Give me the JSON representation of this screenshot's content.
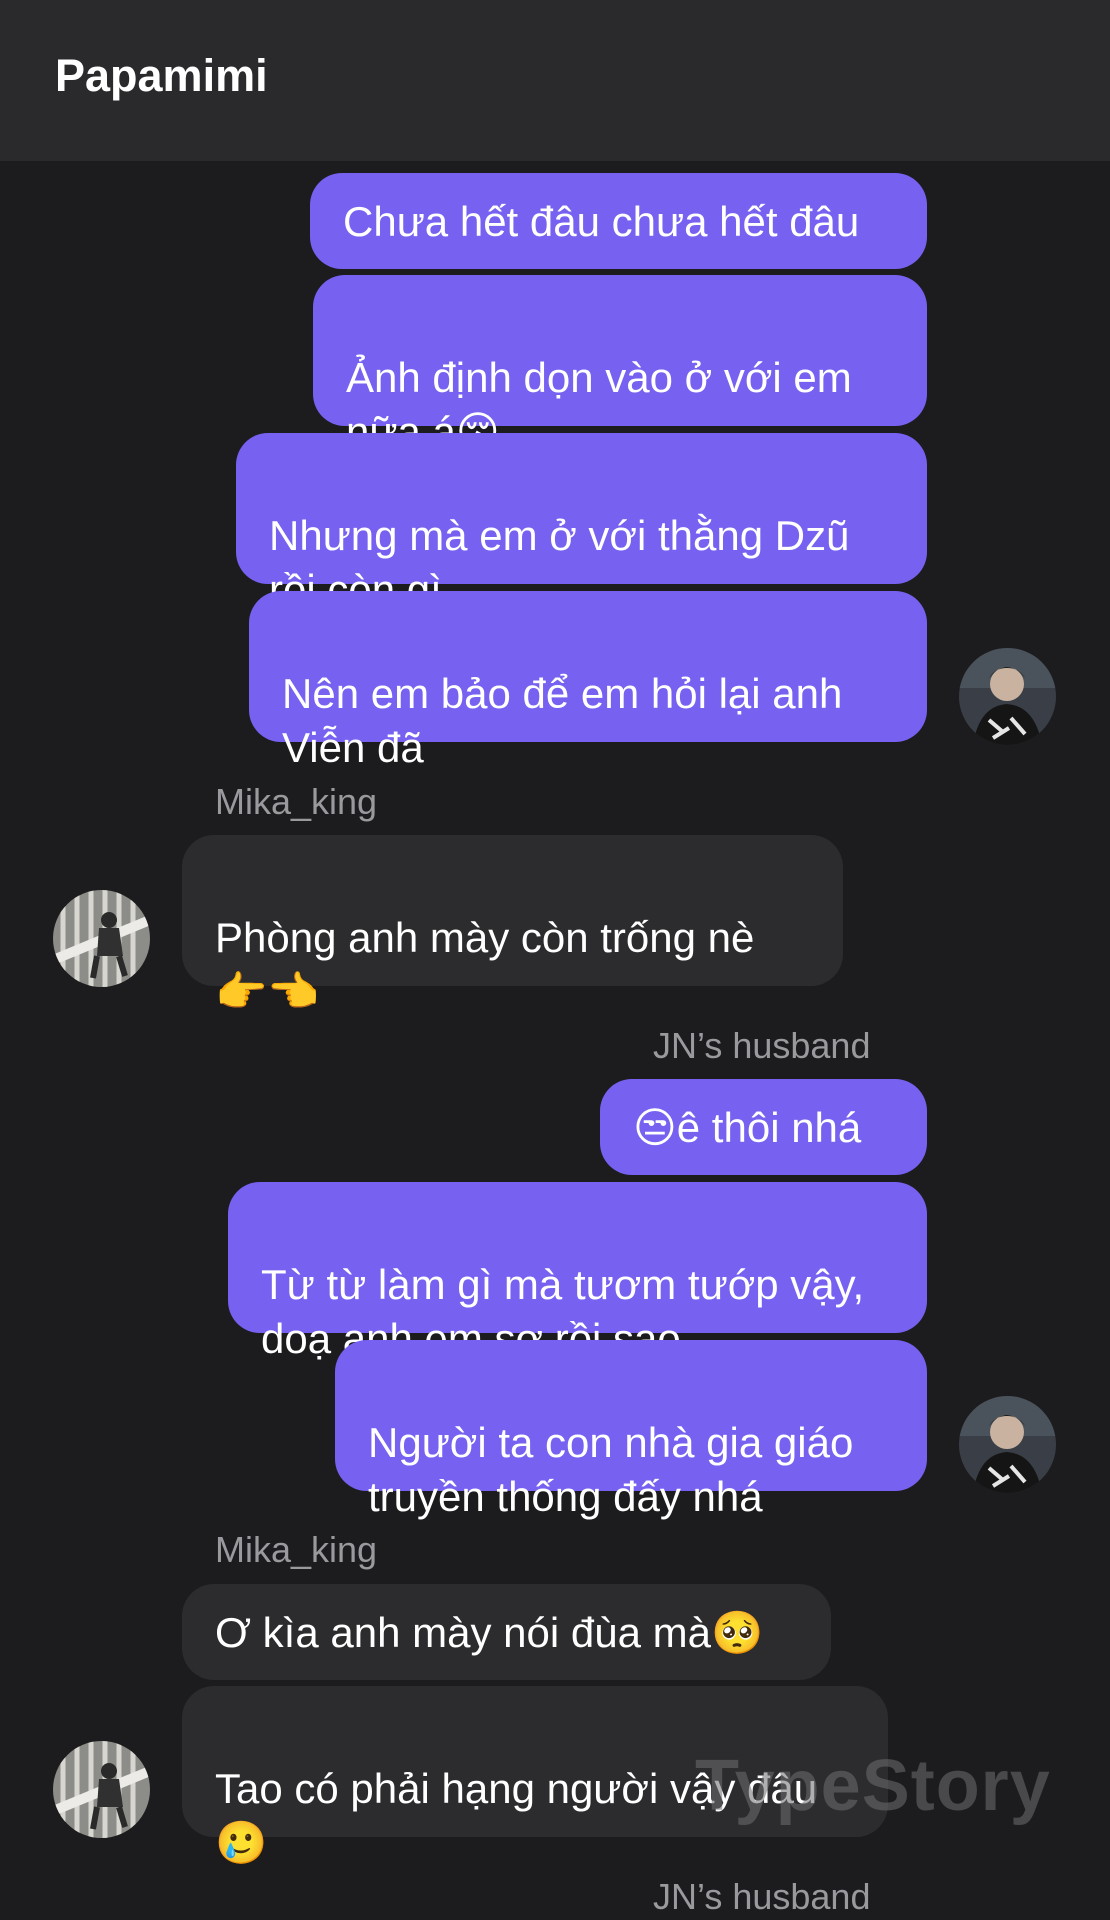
{
  "header": {
    "title": "Papamimi"
  },
  "messages": [
    {
      "text": "Chưa hết đâu chưa hết đâu"
    },
    {
      "text": "Ảnh định dọn vào ở với em\nnữa á😚"
    },
    {
      "text": "Nhưng mà em ở với thằng Dzũ\nrồi còn gì"
    },
    {
      "text": "Nên em bảo để em hỏi lại anh\nViễn đã"
    },
    {
      "text": "Phòng anh mày còn trống nè\n👉👈"
    },
    {
      "text": "😒ê thôi nhá"
    },
    {
      "text": "Từ từ làm gì mà tươm tướp vậy,\ndoạ anh em sợ rồi sao"
    },
    {
      "text": "Người ta con nhà gia giáo\ntruyền thống đấy nhá"
    },
    {
      "text": "Ơ kìa anh mày nói đùa mà🥺"
    },
    {
      "text": "Tao có phải hạng người vậy đâu\n🥲"
    }
  ],
  "senders": {
    "mika": "Mika_king",
    "jn": "JN’s husband"
  },
  "watermark": "TypeStory",
  "colors": {
    "background": "#1c1c1e",
    "header": "#2a2a2c",
    "outgoing_bubble": "#7661f1",
    "incoming_bubble": "#2c2c2e",
    "sender_name": "#9a9a9e"
  }
}
